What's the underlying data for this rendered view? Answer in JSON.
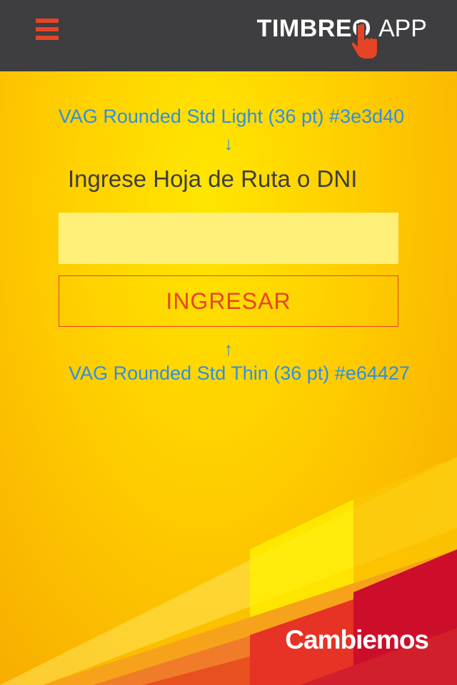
{
  "header": {
    "logo_main": "TIMBREO",
    "logo_sub": "APP",
    "menu_icon": "hamburger-icon",
    "hand_icon": "pointing-hand-icon"
  },
  "annotations": {
    "top_label": "VAG Rounded Std Light (36 pt) #3e3d40",
    "arrow_down": "↓",
    "arrow_up": "↑",
    "bottom_label": "VAG Rounded Std Thin (36 pt) #e64427"
  },
  "form": {
    "prompt": "Ingrese Hoja de Ruta o DNI",
    "input_value": "",
    "input_placeholder": "",
    "submit_label": "INGRESAR"
  },
  "footer": {
    "brand": "Cambiemos"
  },
  "colors": {
    "header_bg": "#3e3d40",
    "accent": "#e64427",
    "annotation": "#2f8fe0",
    "input_bg": "#fff07a"
  }
}
